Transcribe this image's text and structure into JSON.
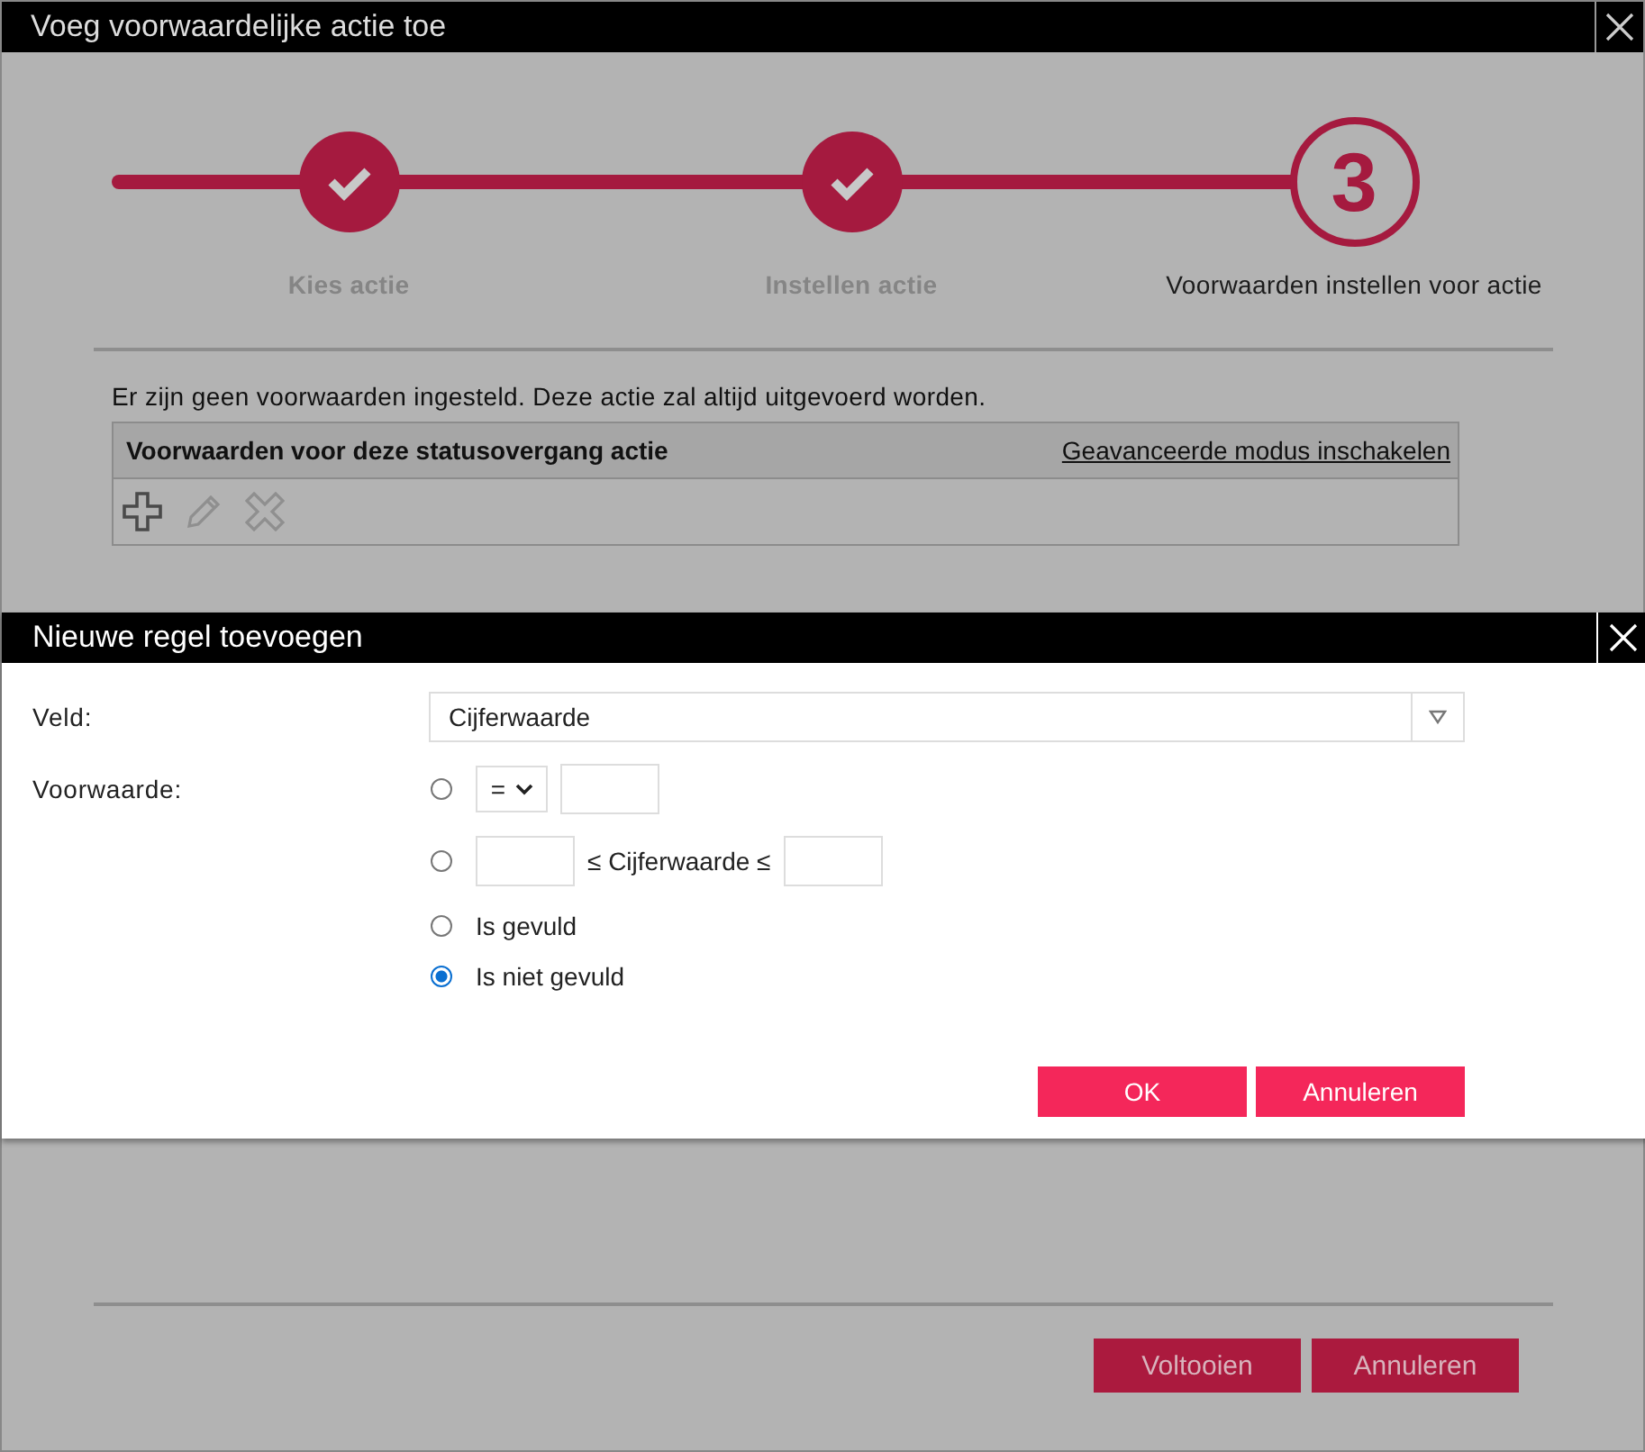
{
  "window": {
    "title": "Voeg voorwaardelijke actie toe"
  },
  "steps": [
    {
      "label": "Kies actie",
      "completed": true
    },
    {
      "label": "Instellen actie",
      "completed": true
    },
    {
      "label": "Voorwaarden instellen voor actie",
      "completed": false,
      "number": "3"
    }
  ],
  "message": "Er zijn geen voorwaarden ingesteld. Deze actie zal altijd uitgevoerd worden.",
  "conditions_table": {
    "title": "Voorwaarden voor deze statusovergang actie",
    "link": "Geavanceerde modus inschakelen",
    "tools": [
      {
        "kind": "add",
        "disabled": false
      },
      {
        "kind": "edit",
        "disabled": true
      },
      {
        "kind": "delete",
        "disabled": true
      }
    ]
  },
  "footer_buttons": [
    "Voltooien",
    "Annuleren"
  ],
  "modal": {
    "title": "Nieuwe regel toevoegen",
    "field": {
      "label": "Veld:",
      "value": "Cijferwaarde"
    },
    "condition_label": "Voorwaarde:",
    "options": [
      {
        "kind": "operator",
        "operator": "=",
        "selected": false
      },
      {
        "kind": "range",
        "text": "≤ Cijferwaarde ≤",
        "selected": false
      },
      {
        "kind": "plain",
        "text": "Is gevuld",
        "selected": false
      },
      {
        "kind": "plain",
        "text": "Is niet gevuld",
        "selected": true
      }
    ],
    "buttons": [
      "OK",
      "Annuleren"
    ]
  }
}
